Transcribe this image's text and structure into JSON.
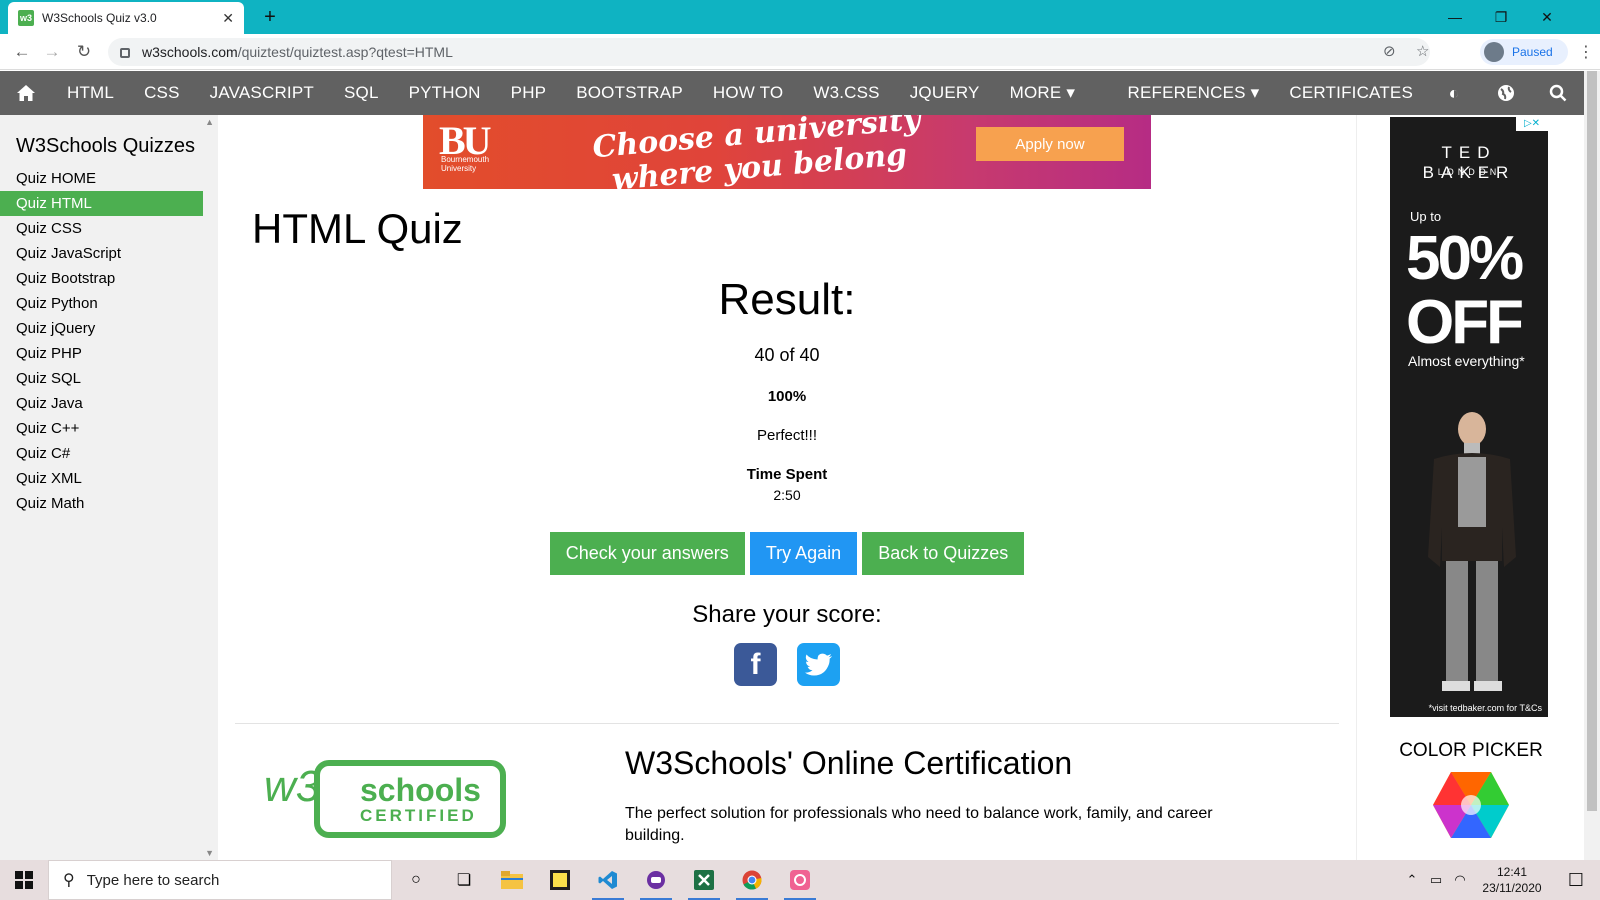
{
  "browser": {
    "tab_title": "W3Schools Quiz v3.0",
    "tab_favicon": "w3",
    "url_host": "w3schools.com",
    "url_path": "/quiztest/quiztest.asp?qtest=HTML",
    "profile_status": "Paused"
  },
  "topnav": {
    "items": [
      "HTML",
      "CSS",
      "JAVASCRIPT",
      "SQL",
      "PYTHON",
      "PHP",
      "BOOTSTRAP",
      "HOW TO",
      "W3.CSS",
      "JQUERY",
      "MORE ▾"
    ],
    "right_items": [
      "REFERENCES ▾",
      "CERTIFICATES"
    ]
  },
  "sidebar": {
    "title": "W3Schools Quizzes",
    "items": [
      "Quiz HOME",
      "Quiz HTML",
      "Quiz CSS",
      "Quiz JavaScript",
      "Quiz Bootstrap",
      "Quiz Python",
      "Quiz jQuery",
      "Quiz PHP",
      "Quiz SQL",
      "Quiz Java",
      "Quiz C++",
      "Quiz C#",
      "Quiz XML",
      "Quiz Math"
    ],
    "active_index": 1
  },
  "ad_top": {
    "logo": "BU",
    "org_line1": "Bournemouth",
    "org_line2": "University",
    "slogan": "Choose a university where you belong",
    "cta": "Apply now"
  },
  "main": {
    "page_title": "HTML Quiz",
    "result_title": "Result:",
    "score": "40 of 40",
    "percent": "100%",
    "verdict": "Perfect!!!",
    "time_label": "Time Spent",
    "time_value": "2:50",
    "buttons": {
      "check": "Check your answers",
      "retry": "Try Again",
      "back": "Back to Quizzes"
    },
    "share_label": "Share your score:",
    "cert_logo_top": "w3",
    "cert_logo_mid": "schools",
    "cert_logo_bottom": "CERTIFIED",
    "cert_title": "W3Schools' Online Certification",
    "cert_text": "The perfect solution for professionals who need to balance work, family, and career building."
  },
  "ad_right": {
    "adchoices": "▷✕",
    "brand": "TED BAKER",
    "brand_sub": "LONDON",
    "upto": "Up to",
    "big_line1": "50%",
    "big_line2": "OFF",
    "almost": "Almost everything*",
    "tcs": "*visit tedbaker.com for T&Cs"
  },
  "rail": {
    "picker_title": "COLOR PICKER"
  },
  "taskbar": {
    "search_placeholder": "Type here to search",
    "time": "12:41",
    "date": "23/11/2020"
  },
  "colors": {
    "w3_green": "#4caf50",
    "w3_blue": "#2196f3",
    "nav_gray": "#616161",
    "chrome_teal": "#0fb3c2"
  }
}
